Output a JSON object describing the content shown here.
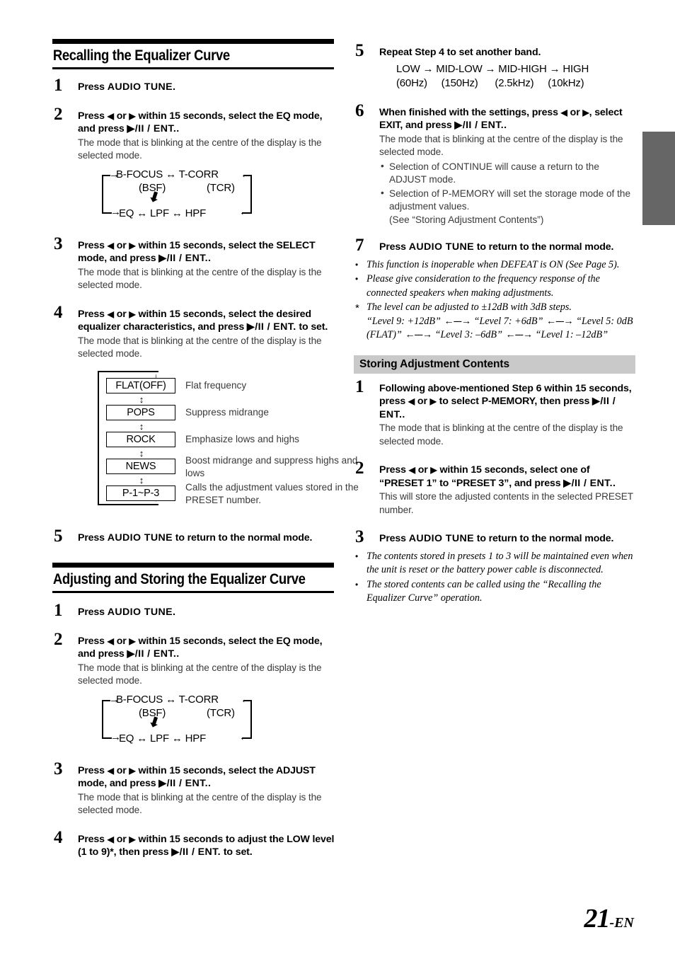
{
  "page": {
    "number": "21",
    "suffix": "-EN"
  },
  "left_column": {
    "section1": {
      "heading": "Recalling the Equalizer Curve",
      "steps": [
        {
          "num": "1",
          "lead_pre": "Press ",
          "lead_ui": "AUDIO TUNE",
          "lead_post": "."
        },
        {
          "num": "2",
          "lead_a": "Press ",
          "lead_left": "◀",
          "lead_b": " or ",
          "lead_right": "▶",
          "lead_c": " within 15 seconds, select the EQ mode, and press ",
          "lead_ent": "▶/II / ENT.",
          "lead_d": ".",
          "body": "The mode that is blinking at the centre of the display is the selected mode."
        },
        {
          "num": "3",
          "lead_a": "Press ",
          "lead_left": "◀",
          "lead_b": " or ",
          "lead_right": "▶",
          "lead_c": " within 15 seconds, select the SELECT mode, and press ",
          "lead_ent": "▶/II / ENT.",
          "lead_d": ".",
          "body": "The mode that is blinking at the centre of the display is the selected mode."
        },
        {
          "num": "4",
          "lead_a": "Press ",
          "lead_left": "◀",
          "lead_b": " or ",
          "lead_right": "▶",
          "lead_c": " within 15 seconds, select the desired equalizer characteristics, and press ",
          "lead_ent": "▶/II / ENT.",
          "lead_d": " to set.",
          "body": "The mode that is blinking at the centre of the display is the selected mode."
        },
        {
          "num": "5",
          "lead_pre": "Press ",
          "lead_ui": "AUDIO TUNE",
          "lead_post": " to return to the normal mode."
        }
      ],
      "mode_diagram": {
        "row1": "B-FOCUS ↔ T-CORR",
        "sub_left": "(BSF)",
        "sub_right": "(TCR)",
        "row2": "EQ ↔ LPF ↔ HPF",
        "arrow_in_left": "→",
        "arrow_in_right": "←",
        "arrow_in_left2": "→",
        "arrow_in_right2": "←",
        "down_arrow": "⬇"
      },
      "eq_list": {
        "entry_arrow": "↓",
        "exit_arrow": "↑",
        "connector": "↕",
        "items": [
          {
            "label": "FLAT(OFF)",
            "desc": "Flat frequency"
          },
          {
            "label": "POPS",
            "desc": "Suppress midrange"
          },
          {
            "label": "ROCK",
            "desc": "Emphasize lows and highs"
          },
          {
            "label": "NEWS",
            "desc": "Boost midrange and suppress highs and lows"
          },
          {
            "label": "P-1~P-3",
            "desc": "Calls the adjustment values stored in the PRESET number."
          }
        ]
      }
    },
    "section2": {
      "heading": "Adjusting and Storing the Equalizer Curve",
      "steps": [
        {
          "num": "1",
          "lead_pre": "Press ",
          "lead_ui": "AUDIO TUNE",
          "lead_post": "."
        },
        {
          "num": "2",
          "lead_a": "Press ",
          "lead_left": "◀",
          "lead_b": " or ",
          "lead_right": "▶",
          "lead_c": " within 15 seconds, select the EQ mode, and press ",
          "lead_ent": "▶/II / ENT.",
          "lead_d": ".",
          "body": "The mode that is blinking at the centre of the display is the selected mode."
        },
        {
          "num": "3",
          "lead_a": "Press ",
          "lead_left": "◀",
          "lead_b": " or ",
          "lead_right": "▶",
          "lead_c": " within 15 seconds, select the ADJUST mode, and press ",
          "lead_ent": "▶/II / ENT.",
          "lead_d": ".",
          "body": "The mode that is blinking at the centre of the display is the selected mode."
        },
        {
          "num": "4",
          "lead_a": "Press ",
          "lead_left": "◀",
          "lead_b": " or ",
          "lead_right": "▶",
          "lead_c": " within 15 seconds to adjust the LOW level (1 to 9)*, then press ",
          "lead_ent": "▶/II / ENT.",
          "lead_d": " to set."
        }
      ],
      "mode_diagram": {
        "row1": "B-FOCUS ↔ T-CORR",
        "sub_left": "(BSF)",
        "sub_right": "(TCR)",
        "row2": "EQ ↔ LPF ↔ HPF"
      }
    }
  },
  "right_column": {
    "steps": [
      {
        "num": "5",
        "lead": "Repeat Step 4 to set another band.",
        "band_flow_line1": "LOW → MID-LOW → MID-HIGH →  HIGH",
        "band_flow_line2": "(60Hz)     (150Hz)      (2.5kHz)     (10kHz)"
      },
      {
        "num": "6",
        "lead_a": "When finished with the settings, press ",
        "lead_left": "◀",
        "lead_b": " or ",
        "lead_right": "▶",
        "lead_c": ", select EXIT, and press ",
        "lead_ent": "▶/II / ENT.",
        "lead_d": ".",
        "body": "The mode that is blinking at the centre of the display is the selected mode.",
        "bullets": [
          "Selection of CONTINUE will cause a return to the ADJUST mode.",
          "Selection of P-MEMORY will set the storage mode of the adjustment values."
        ],
        "bullet_sub": "(See “Storing Adjustment Contents”)"
      },
      {
        "num": "7",
        "lead_pre": "Press ",
        "lead_ui": "AUDIO TUNE",
        "lead_post": " to return to the normal mode."
      }
    ],
    "notes": [
      {
        "mark": "•",
        "text": "This function is inoperable when DEFEAT is ON (See Page 5)."
      },
      {
        "mark": "•",
        "text": "Please give consideration to the frequency response of the connected speakers when making adjustments."
      }
    ],
    "note_asterisk": {
      "mark": "*",
      "text": "The level can be adjusted to ±12dB with 3dB steps.",
      "chain": [
        "“Level 9: +12dB”",
        "“Level 7: +6dB”",
        "“Level 5: 0dB (FLAT)”",
        "“Level 3: –6dB”",
        "“Level 1: –12dB”"
      ],
      "arrow": "←---→"
    },
    "subsection": {
      "heading": "Storing Adjustment Contents",
      "steps": [
        {
          "num": "1",
          "lead_a": "Following above-mentioned Step 6 within 15 seconds, press ",
          "lead_left": "◀",
          "lead_b": " or ",
          "lead_right": "▶",
          "lead_c": " to select P-MEMORY, then press ",
          "lead_ent": "▶/II / ENT.",
          "lead_d": ".",
          "body": "The mode that is blinking at the centre of the display is the selected mode."
        },
        {
          "num": "2",
          "lead_a": "Press ",
          "lead_left": "◀",
          "lead_b": " or ",
          "lead_right": "▶",
          "lead_c": " within 15 seconds, select one of “PRESET 1” to “PRESET 3”, and press ",
          "lead_ent": "▶/II / ENT.",
          "lead_d": ".",
          "body": "This will store the adjusted contents in the selected PRESET number."
        },
        {
          "num": "3",
          "lead_pre": "Press ",
          "lead_ui": "AUDIO TUNE",
          "lead_post": " to return to the normal mode."
        }
      ],
      "notes": [
        {
          "mark": "•",
          "text": "The contents stored in presets 1 to 3 will be maintained even when the unit is reset or the battery power cable is disconnected."
        },
        {
          "mark": "•",
          "text": "The stored contents can be called using the “Recalling the Equalizer Curve” operation."
        }
      ]
    }
  }
}
